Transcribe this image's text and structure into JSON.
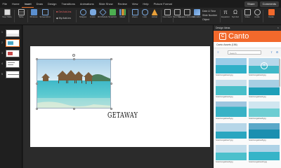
{
  "tabs": [
    "File",
    "Home",
    "Insert",
    "Draw",
    "Design",
    "Transitions",
    "Animations",
    "Slide Show",
    "Review",
    "View",
    "Help",
    "Picture Format"
  ],
  "active_tab": "Insert",
  "share_label": "Share",
  "comments_label": "Comments",
  "ribbon": {
    "new_slide": "New Slide",
    "table": "Table",
    "pictures": "Pictures",
    "screenshot": "Screenshot",
    "get_addins": "Get Add-ins",
    "my_addins": "My Add-ins",
    "shapes": "Shapes",
    "icons": "Icons",
    "models_3d": "3D Models",
    "smartart": "SmartArt",
    "chart": "Chart",
    "zoom": "Zoom",
    "link": "Link",
    "action": "Action",
    "comment": "Comment",
    "text_box": "Text Box",
    "header_footer": "Header & Footer",
    "wordart": "WordArt",
    "date_time": "Date & Time",
    "slide_number": "Slide Number",
    "object": "Object",
    "equation": "Equation",
    "symbol": "Symbol",
    "video": "Video",
    "audio": "Audio",
    "canto": "Canto"
  },
  "slides": [
    "1",
    "2",
    "3",
    "4",
    "5"
  ],
  "slide": {
    "caption": "GETAWAY"
  },
  "panel": {
    "title": "Design Ideas",
    "close": "×",
    "brand_name": "Canto",
    "assets_label": "Canto Assets (156)",
    "search_placeholder": "Search",
    "files": [
      "hotel-bungalows1.jpg",
      "hotel-bungalows2.jpg",
      "hotel-bungalows3.jpg",
      "hotel-bungalows4.jpg",
      "hotel-bungalows5.jpg",
      "hotel-bungalows6.jpg",
      "hotel-bungalows7.jpg",
      "hotel-bungalows8.jpg",
      "hotel-bungalows9.jpg",
      "hotel-bungalows10.jpg"
    ]
  },
  "colors": {
    "accent": "#e8712a",
    "brand": "#f2692c",
    "ribbon_bg": "#262626",
    "canvas_bg": "#2b2b2b"
  }
}
